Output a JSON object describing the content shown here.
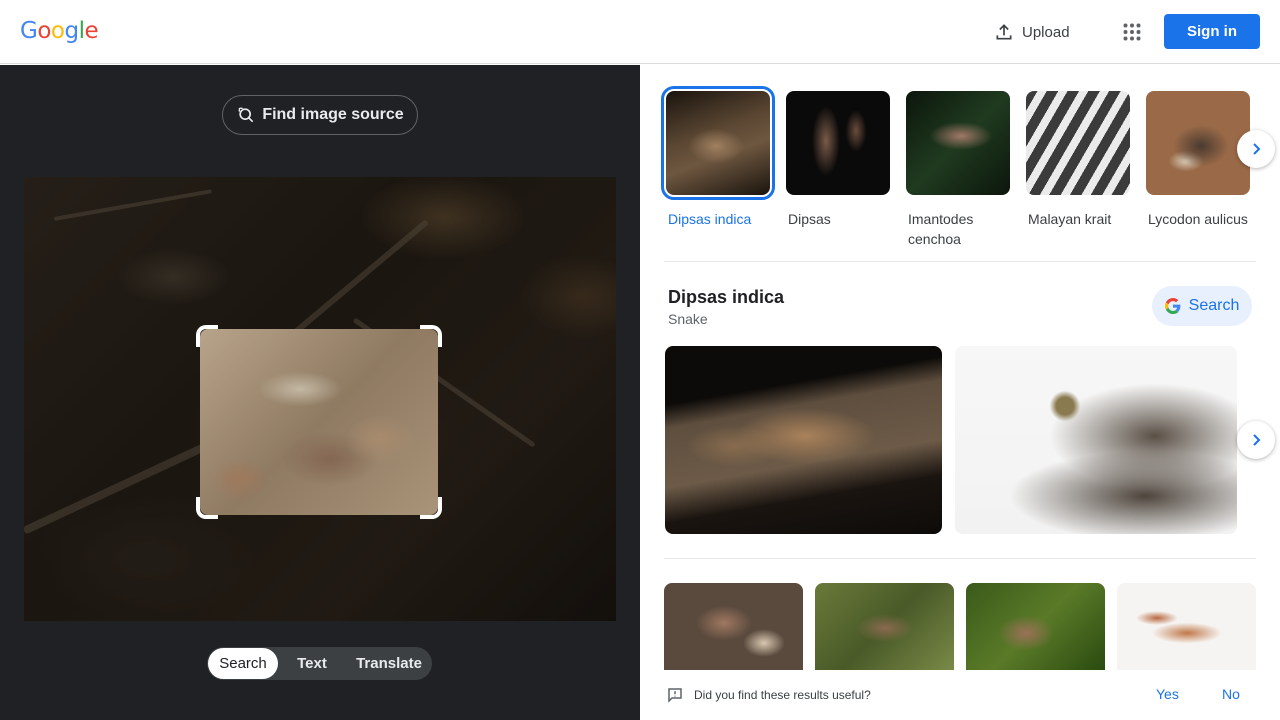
{
  "header": {
    "logo_letters": [
      {
        "char": "G",
        "color": "#4285F4"
      },
      {
        "char": "o",
        "color": "#EA4335"
      },
      {
        "char": "o",
        "color": "#FBBC05"
      },
      {
        "char": "g",
        "color": "#4285F4"
      },
      {
        "char": "l",
        "color": "#34A853"
      },
      {
        "char": "e",
        "color": "#EA4335"
      }
    ],
    "upload_label": "Upload",
    "upload_icon": "upload-icon",
    "apps_icon": "apps-grid-icon",
    "signin_label": "Sign in",
    "accent_color": "#1a73e8"
  },
  "lens": {
    "find_source_label": "Find image source",
    "find_source_icon": "lens-search-icon",
    "modes": [
      {
        "label": "Search",
        "active": true
      },
      {
        "label": "Text",
        "active": false
      },
      {
        "label": "Translate",
        "active": false
      }
    ]
  },
  "results": {
    "visual_matches": [
      {
        "label": "Dipsas indica",
        "selected": true
      },
      {
        "label": "Dipsas",
        "selected": false
      },
      {
        "label": "Imantodes cenchoa",
        "selected": false
      },
      {
        "label": "Malayan krait",
        "selected": false
      },
      {
        "label": "Lycodon aulicus",
        "selected": false
      }
    ],
    "next_icon": "chevron-right-icon",
    "knowledge": {
      "title": "Dipsas indica",
      "subtitle": "Snake",
      "search_label": "Search",
      "search_icon": "google-g-icon"
    }
  },
  "feedback": {
    "question": "Did you find these results useful?",
    "icon": "feedback-icon",
    "yes_label": "Yes",
    "no_label": "No"
  }
}
